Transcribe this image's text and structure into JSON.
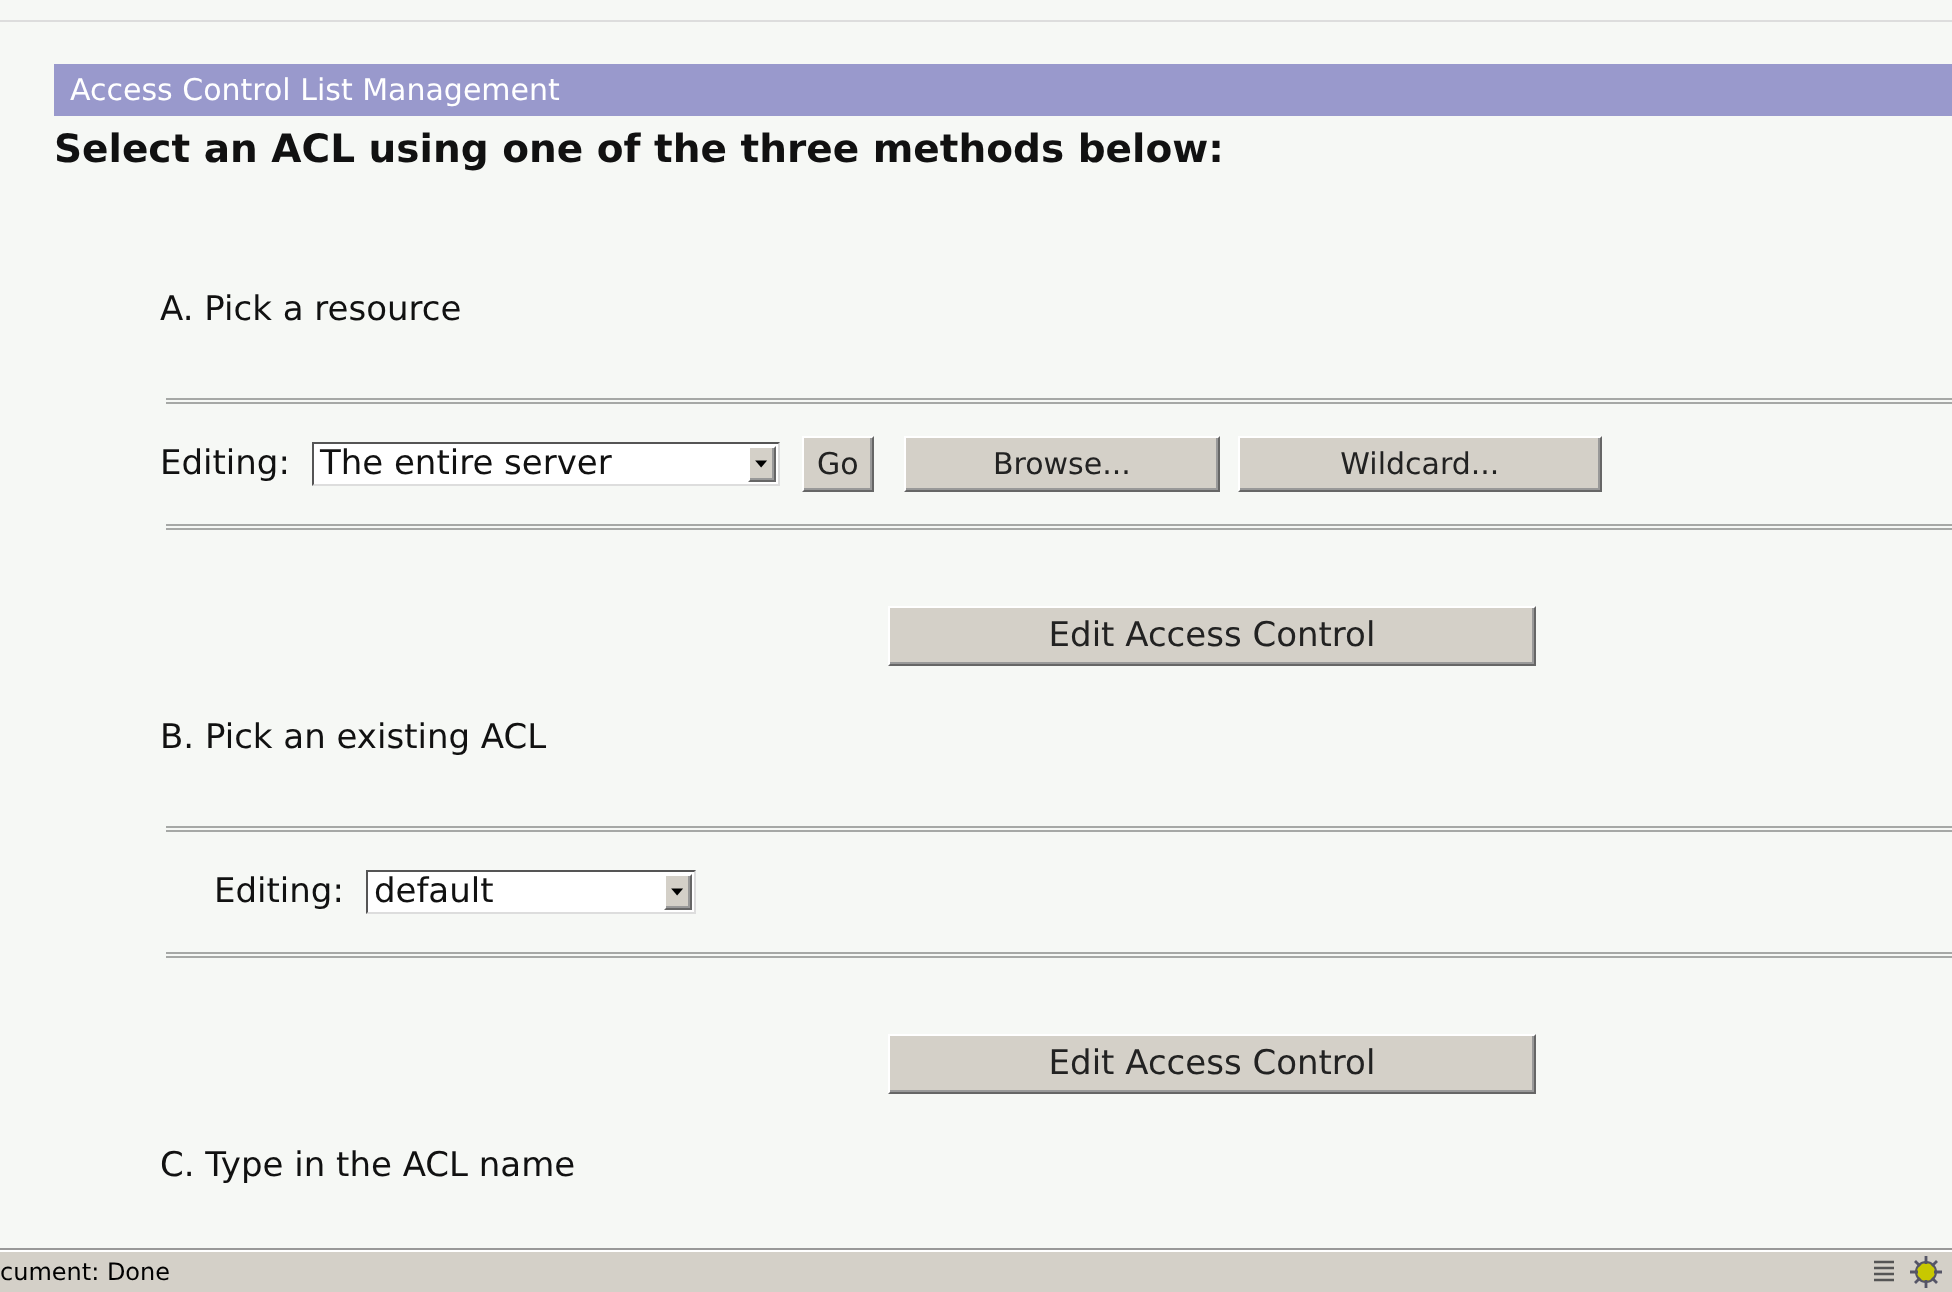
{
  "header": {
    "title": "Access Control List Management"
  },
  "instruction": "Select an ACL using one of the three methods below:",
  "sections": [
    {
      "label": "A. Pick a resource",
      "editing_label": "Editing:",
      "dropdown": {
        "value": "The entire server"
      },
      "buttons": [
        "Go",
        "Browse...",
        "Wildcard..."
      ],
      "submit": "Edit Access Control"
    },
    {
      "label": "B. Pick an existing ACL",
      "editing_label": "Editing:",
      "dropdown": {
        "value": "default"
      },
      "submit": "Edit Access Control"
    },
    {
      "label": "C. Type in the ACL name"
    }
  ],
  "status_bar": {
    "text": "cument: Done"
  }
}
